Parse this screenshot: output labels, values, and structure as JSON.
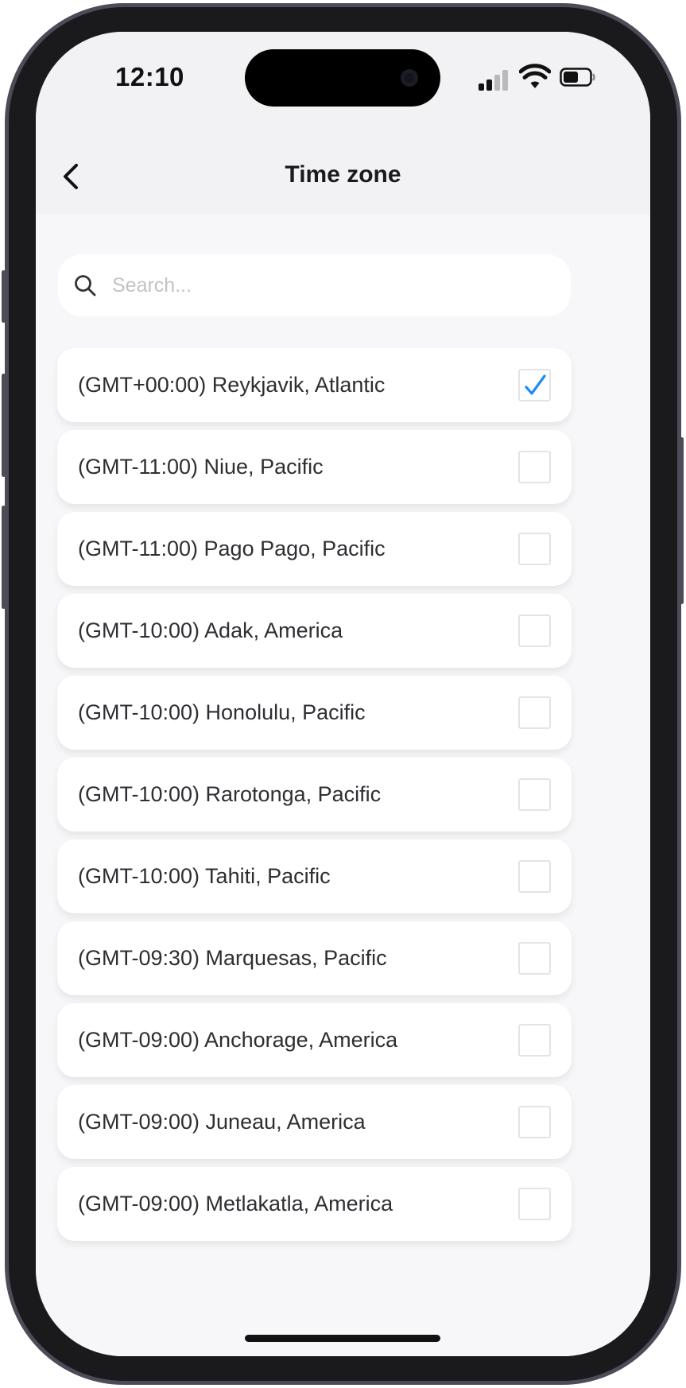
{
  "status_bar": {
    "time": "12:10"
  },
  "nav": {
    "title": "Time zone",
    "back_icon": "chevron-left-icon"
  },
  "search": {
    "placeholder": "Search...",
    "value": "",
    "icon": "search-icon"
  },
  "colors": {
    "accent": "#1b8cf0",
    "checkbox_border": "#e4e4e8",
    "text": "#2e2e33"
  },
  "timezones": [
    {
      "label": "(GMT+00:00) Reykjavik, Atlantic",
      "selected": true
    },
    {
      "label": "(GMT-11:00) Niue, Pacific",
      "selected": false
    },
    {
      "label": "(GMT-11:00) Pago Pago, Pacific",
      "selected": false
    },
    {
      "label": "(GMT-10:00) Adak, America",
      "selected": false
    },
    {
      "label": "(GMT-10:00) Honolulu, Pacific",
      "selected": false
    },
    {
      "label": "(GMT-10:00) Rarotonga, Pacific",
      "selected": false
    },
    {
      "label": "(GMT-10:00) Tahiti, Pacific",
      "selected": false
    },
    {
      "label": "(GMT-09:30) Marquesas, Pacific",
      "selected": false
    },
    {
      "label": "(GMT-09:00) Anchorage, America",
      "selected": false
    },
    {
      "label": "(GMT-09:00) Juneau, America",
      "selected": false
    },
    {
      "label": "(GMT-09:00) Metlakatla, America",
      "selected": false
    }
  ]
}
